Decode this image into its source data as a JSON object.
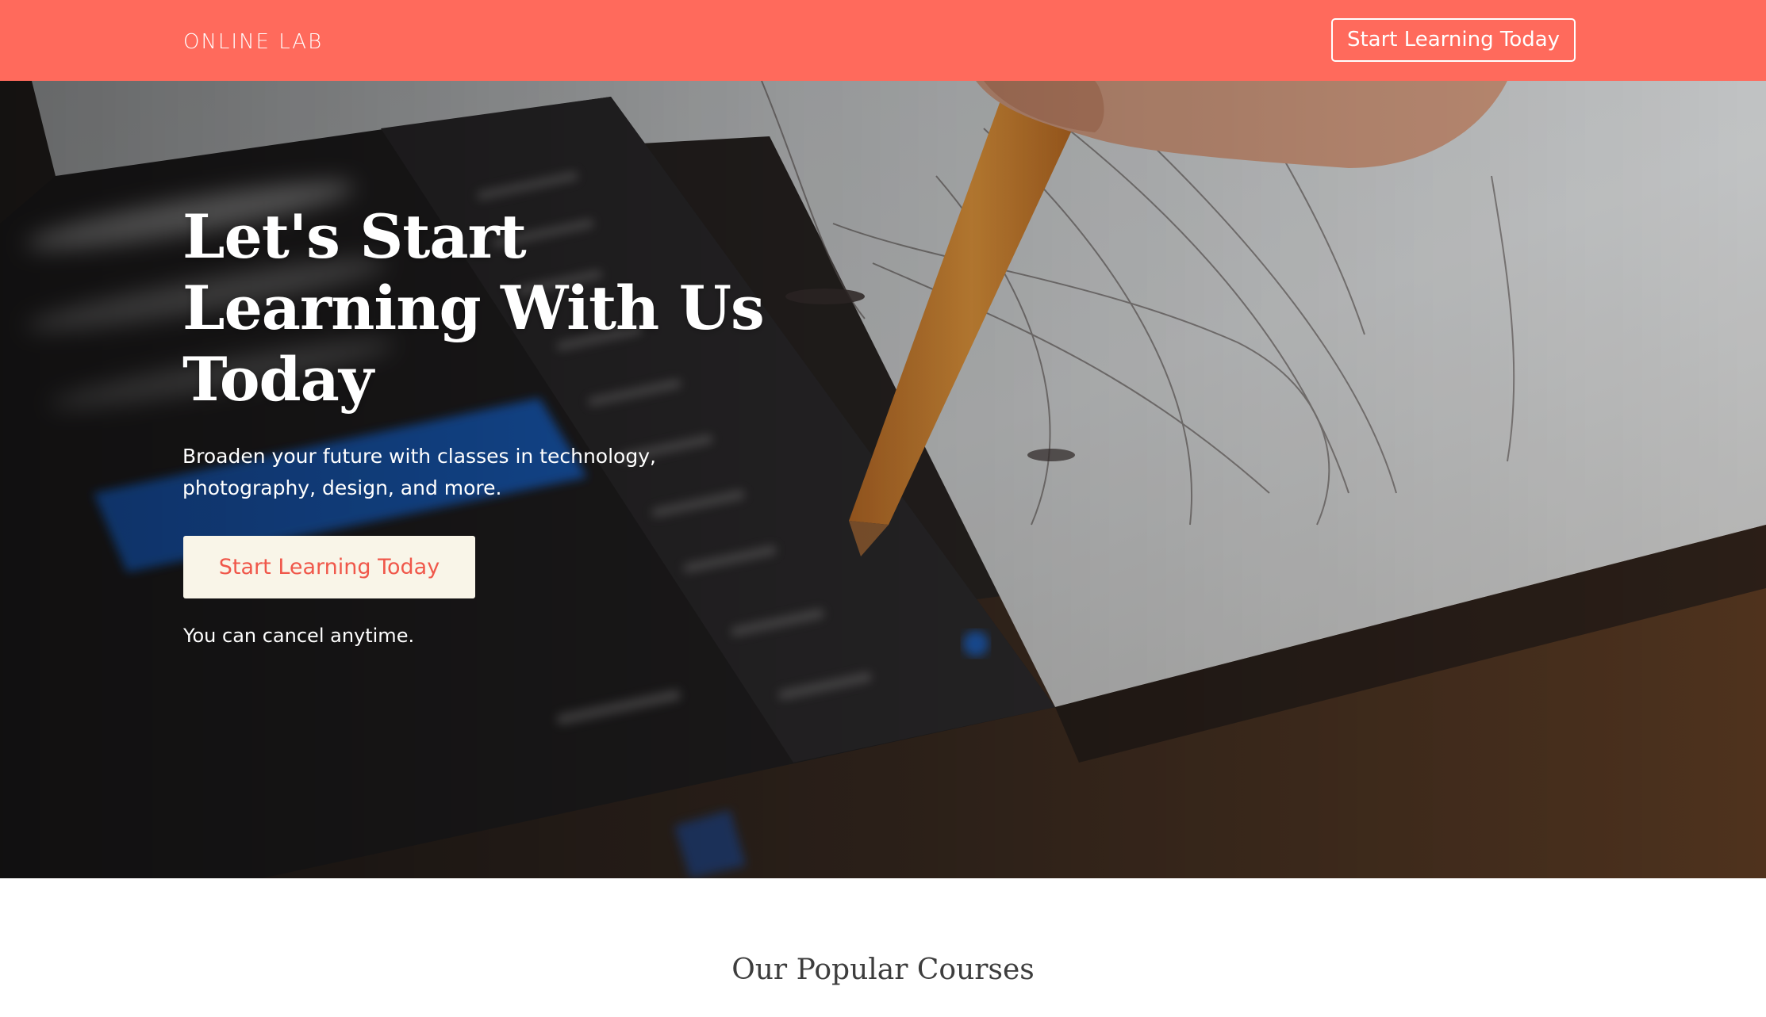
{
  "header": {
    "logo": "ONLINE LAB",
    "cta_label": "Start Learning Today"
  },
  "hero": {
    "title": "Let's Start Learning With Us Today",
    "subtitle": "Broaden your future with classes in technology, photography, design, and more.",
    "cta_label": "Start Learning Today",
    "note": "You can cancel anytime."
  },
  "popular": {
    "title": "Our Popular Courses"
  },
  "colors": {
    "header_bg": "#ff6a5c",
    "hero_cta_bg": "#f9f5e8",
    "hero_cta_text": "#f0574a",
    "section_title": "#3d3d3d"
  }
}
